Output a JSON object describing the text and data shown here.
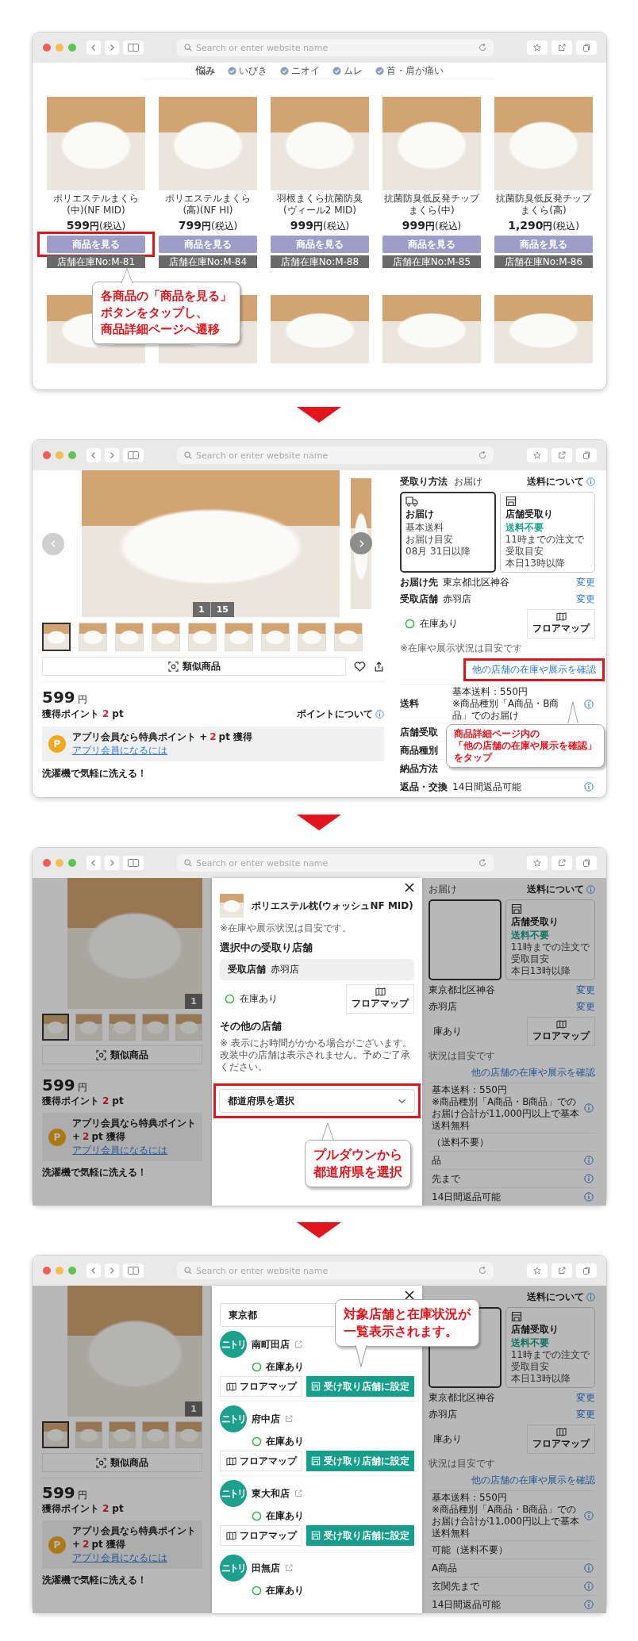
{
  "panels": [
    {
      "kind": "listing",
      "address_placeholder": "Search or enter website name",
      "filters": {
        "label": "悩み",
        "options": [
          "いびき",
          "ニオイ",
          "ムレ",
          "首・肩が痛い"
        ]
      },
      "products": [
        {
          "name": "ポリエステルまくら(中)(NF MID)",
          "price": "599",
          "currency": "円",
          "tax": "(税込)",
          "button": "商品を見る",
          "stock_no": "店舗在庫No:M-81",
          "highlighted": true
        },
        {
          "name": "ポリエステルまくら(高)(NF HI)",
          "price": "799",
          "currency": "円",
          "tax": "(税込)",
          "button": "商品を見る",
          "stock_no": "店舗在庫No:M-84",
          "highlighted": false
        },
        {
          "name": "羽根まくら抗菌防臭(ヴィール2 MID)",
          "price": "999",
          "currency": "円",
          "tax": "(税込)",
          "button": "商品を見る",
          "stock_no": "店舗在庫No:M-88",
          "highlighted": false
        },
        {
          "name": "抗菌防臭低反発チップまくら(中)",
          "price": "999",
          "currency": "円",
          "tax": "(税込)",
          "button": "商品を見る",
          "stock_no": "店舗在庫No:M-85",
          "highlighted": false
        },
        {
          "name": "抗菌防臭低反発チップまくら(高)",
          "price": "1,290",
          "currency": "円",
          "tax": "(税込)",
          "button": "商品を見る",
          "stock_no": "店舗在庫No:M-86",
          "highlighted": false
        }
      ],
      "callout": [
        "各商品の「商品を見る」",
        "ボタンをタップし、",
        "商品詳細ページへ遷移"
      ]
    },
    {
      "kind": "detail",
      "address_placeholder": "Search or enter website name",
      "left": {
        "gallery": {
          "nav": true,
          "counter_current": "1",
          "counter_total": "15",
          "thumbnails": [
            {
              "selected": true
            },
            {
              "selected": false
            },
            {
              "selected": false
            },
            {
              "selected": false
            },
            {
              "selected": false
            },
            {
              "selected": false
            },
            {
              "selected": false
            },
            {
              "selected": false
            },
            {
              "selected": false
            }
          ]
        },
        "actions": {
          "similar": "類似商品",
          "icons": true
        },
        "price": {
          "value": "599",
          "currency": "円"
        },
        "points": {
          "label": "獲得ポイント",
          "value": "2",
          "unit": "pt",
          "about": "ポイントについて"
        },
        "app_offer": {
          "badge": "P",
          "before": "アプリ会員なら特典ポイント +",
          "value": "2",
          "after": "pt 獲得",
          "link": "アプリ会員になるには"
        },
        "tagline": "洗濯機で気軽に洗える！"
      },
      "right": {
        "method": {
          "label": "受取り方法",
          "value": "お届け"
        },
        "shipping_link": "送料について",
        "options": [
          {
            "kind": "truck",
            "title": "お届け",
            "lines": [
              {
                "kind": "plain",
                "text": "基本送料"
              },
              {
                "kind": "plain",
                "text": "お届け目安"
              },
              {
                "kind": "plain",
                "text": "08月 31日以降"
              }
            ],
            "selected": true
          },
          {
            "kind": "store",
            "title": "店舗受取り",
            "lines": [
              {
                "kind": "accent",
                "text": "送料不要"
              },
              {
                "kind": "plain",
                "text": "11時までの注文で"
              },
              {
                "kind": "plain",
                "text": "受取目安"
              },
              {
                "kind": "plain",
                "text": "本日13時以降"
              }
            ],
            "selected": false
          }
        ],
        "rows": [
          {
            "label": "お届け先",
            "value": "東京都北区神谷",
            "action": "変更"
          },
          {
            "label": "受取店舗",
            "value": "赤羽店",
            "action": "変更"
          }
        ],
        "stock": {
          "mark": true,
          "text": "在庫あり"
        },
        "floor_map": "フロアマップ",
        "note": "※在庫や展示状況は目安です",
        "other_link": {
          "text": "他の店舗の在庫や展示を確認",
          "highlighted": true
        },
        "table": [
          {
            "label": "送料",
            "value": "基本送料：550円",
            "value_note": "※商品種別「A商品・B商品」でのお届け",
            "info": true
          },
          {
            "label": "店舗受取",
            "info": false
          },
          {
            "label": "商品種別",
            "info": false
          },
          {
            "label": "納品方法",
            "info": false
          },
          {
            "label": "返品・交換",
            "value": "14日間返品可能",
            "info": true
          }
        ]
      },
      "callout": [
        "商品詳細ページ内の",
        "「他の店舗の在庫や展示を確認」",
        "をタップ"
      ]
    },
    {
      "kind": "modal",
      "address_placeholder": "Search or enter website name",
      "backdrop": {
        "left": {
          "gallery": {
            "counter_current": "1",
            "thumbnails": [
              {
                "selected": true
              },
              {
                "selected": false
              },
              {
                "selected": false
              },
              {
                "selected": false
              },
              {
                "selected": false
              }
            ]
          },
          "actions": {
            "similar": "類似商品"
          },
          "price": {
            "value": "599",
            "currency": "円"
          },
          "points": {
            "label": "獲得ポイント",
            "value": "2",
            "unit": "pt"
          },
          "app_offer": {
            "badge": "P",
            "before": "アプリ会員なら特典ポイント +",
            "value": "2",
            "after": "pt 獲得",
            "link": "アプリ会員になるには"
          },
          "tagline": "洗濯機で気軽に洗える！"
        },
        "right": {
          "method": {
            "value": "お届け"
          },
          "shipping_link": "送料について",
          "options": [
            {
              "kind": "blank",
              "selected": true
            },
            {
              "kind": "store",
              "title": "店舗受取り",
              "lines": [
                {
                  "kind": "accent",
                  "text": "送料不要"
                },
                {
                  "kind": "plain",
                  "text": "11時までの注文で"
                },
                {
                  "kind": "plain",
                  "text": "受取目安"
                },
                {
                  "kind": "plain",
                  "text": "本日13時以降"
                }
              ],
              "selected": false
            }
          ],
          "rows": [
            {
              "value": "東京都北区神谷",
              "action": "変更"
            },
            {
              "value": "赤羽店",
              "action": "変更"
            }
          ],
          "stock": {
            "text": "庫あり"
          },
          "floor_map": "フロアマップ",
          "note": "状況は目安です",
          "other_link": {
            "text": "他の店舗の在庫や展示を確認",
            "highlighted": false
          },
          "table": [
            {
              "value": "基本送料：550円",
              "value_note": "※商品種別「A商品・B商品」でのお届け合計が11,000円以上で基本送料無料",
              "info": true
            },
            {
              "value": "（送料不要）",
              "info": false
            },
            {
              "value": "品",
              "info": true
            },
            {
              "value": "先まで",
              "info": true
            },
            {
              "value": "14日間返品可能",
              "info": true
            }
          ]
        }
      },
      "modal": {
        "kind": "select",
        "product": "ポリエステル枕(ウォッシュNF MID)",
        "note": "※在庫や展示状況は目安です。",
        "current_heading": "選択中の受取り店舗",
        "current_store": {
          "label": "受取店舗",
          "value": "赤羽店"
        },
        "stock": "在庫あり",
        "floor_map": "フロアマップ",
        "others_heading": "その他の店舗",
        "others_note": [
          "※ 表示にお時間がかかる場合がございます。",
          "改装中の店舗は表示されません。予めご了承ください。"
        ],
        "select": {
          "placeholder": "都道府県を選択",
          "dropdown_icon": true,
          "highlighted": true
        }
      },
      "callout": [
        "プルダウンから",
        "都道府県を選択"
      ]
    },
    {
      "kind": "modal",
      "address_placeholder": "Search or enter website name",
      "backdrop": {
        "left": {
          "gallery": {
            "counter_current": "1",
            "thumbnails": [
              {
                "selected": true
              },
              {
                "selected": false
              },
              {
                "selected": false
              },
              {
                "selected": false
              },
              {
                "selected": false
              }
            ]
          },
          "actions": {
            "similar": "類似商品"
          },
          "price": {
            "value": "599",
            "currency": "円"
          },
          "points": {
            "label": "獲得ポイント",
            "value": "2",
            "unit": "pt"
          },
          "app_offer": {
            "badge": "P",
            "before": "アプリ会員なら特典ポイント +",
            "value": "2",
            "after": "pt 獲得",
            "link": "アプリ会員になるには"
          },
          "tagline": "洗濯機で気軽に洗える！"
        },
        "right": {
          "shipping_link": "送料について",
          "options": [
            {
              "kind": "blank",
              "selected": true
            },
            {
              "kind": "store",
              "title": "店舗受取り",
              "lines": [
                {
                  "kind": "accent",
                  "text": "送料不要"
                },
                {
                  "kind": "plain",
                  "text": "11時までの注文で"
                },
                {
                  "kind": "plain",
                  "text": "受取目安"
                },
                {
                  "kind": "plain",
                  "text": "本日13時以降"
                }
              ],
              "selected": false
            }
          ],
          "rows": [
            {
              "value": "東京都北区神谷",
              "action": "変更"
            },
            {
              "value": "赤羽店",
              "action": "変更"
            }
          ],
          "stock": {
            "text": "庫あり"
          },
          "floor_map": "フロアマップ",
          "note": "状況は目安です",
          "other_link": {
            "text": "他の店舗の在庫や展示を確認",
            "highlighted": false
          },
          "table": [
            {
              "value": "基本送料：550円",
              "value_note": "※商品種別「A商品・B商品」でのお届け合計が11,000円以上で基本送料無料",
              "info": true
            },
            {
              "value": "可能（送料不要）",
              "info": false
            },
            {
              "value": "A商品",
              "info": true
            },
            {
              "value": "玄関先まで",
              "info": true
            },
            {
              "value": "14日間返品可能",
              "info": true
            }
          ]
        }
      },
      "modal": {
        "kind": "stores",
        "select": {
          "value": "東京都"
        },
        "stores": [
          {
            "logo": "ニトリ",
            "name": "南町田店",
            "stock": "在庫あり",
            "floor_map": "フロアマップ",
            "set_button": "受け取り店舗に設定"
          },
          {
            "logo": "ニトリ",
            "name": "府中店",
            "stock": "在庫あり",
            "floor_map": "フロアマップ",
            "set_button": "受け取り店舗に設定"
          },
          {
            "logo": "ニトリ",
            "name": "東大和店",
            "stock": "在庫あり",
            "floor_map": "フロアマップ",
            "set_button": "受け取り店舗に設定"
          },
          {
            "logo": "ニトリ",
            "name": "田無店",
            "stock": "在庫あり"
          }
        ]
      },
      "callout": [
        "対象店舗と在庫状況が",
        "一覧表示されます。"
      ]
    }
  ]
}
